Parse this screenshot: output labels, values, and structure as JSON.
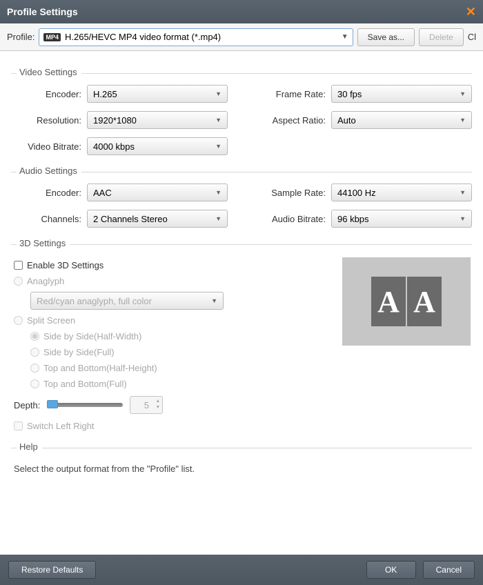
{
  "title": "Profile Settings",
  "toolbar": {
    "profile_label": "Profile:",
    "profile_badge": "MP4",
    "profile_value": "H.265/HEVC MP4 video format (*.mp4)",
    "save_as": "Save as...",
    "delete": "Delete",
    "fragment": "Cl"
  },
  "video": {
    "title": "Video Settings",
    "encoder_label": "Encoder:",
    "encoder": "H.265",
    "resolution_label": "Resolution:",
    "resolution": "1920*1080",
    "bitrate_label": "Video Bitrate:",
    "bitrate": "4000 kbps",
    "framerate_label": "Frame Rate:",
    "framerate": "30 fps",
    "aspect_label": "Aspect Ratio:",
    "aspect": "Auto"
  },
  "audio": {
    "title": "Audio Settings",
    "encoder_label": "Encoder:",
    "encoder": "AAC",
    "channels_label": "Channels:",
    "channels": "2 Channels Stereo",
    "samplerate_label": "Sample Rate:",
    "samplerate": "44100 Hz",
    "bitrate_label": "Audio Bitrate:",
    "bitrate": "96 kbps"
  },
  "threed": {
    "title": "3D Settings",
    "enable": "Enable 3D Settings",
    "anaglyph": "Anaglyph",
    "anaglyph_value": "Red/cyan anaglyph, full color",
    "split": "Split Screen",
    "sbs_half": "Side by Side(Half-Width)",
    "sbs_full": "Side by Side(Full)",
    "tb_half": "Top and Bottom(Half-Height)",
    "tb_full": "Top and Bottom(Full)",
    "depth_label": "Depth:",
    "depth_value": "5",
    "switch": "Switch Left Right",
    "preview_glyph": "A"
  },
  "help": {
    "title": "Help",
    "text": "Select the output format from the \"Profile\" list."
  },
  "footer": {
    "restore": "Restore Defaults",
    "ok": "OK",
    "cancel": "Cancel"
  }
}
